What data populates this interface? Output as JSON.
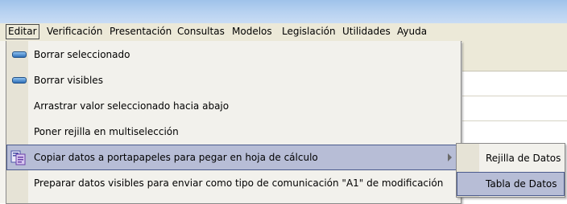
{
  "menubar": {
    "items": [
      {
        "label": "Editar",
        "active": true
      },
      {
        "label": "Verificación",
        "active": false
      },
      {
        "label": "Presentación",
        "active": false
      },
      {
        "label": "Consultas",
        "active": false
      },
      {
        "label": "Modelos",
        "active": false
      },
      {
        "label": "Legislación",
        "active": false
      },
      {
        "label": "Utilidades",
        "active": false
      },
      {
        "label": "Ayuda",
        "active": false
      }
    ]
  },
  "edit_menu": {
    "items": [
      {
        "label": "Borrar seleccionado",
        "icon": "blue-pill-icon"
      },
      {
        "label": "Borrar visibles",
        "icon": "blue-pill-icon"
      },
      {
        "label": "Arrastrar valor seleccionado hacia abajo",
        "icon": ""
      },
      {
        "label": "Poner rejilla en multiselección",
        "icon": ""
      },
      {
        "label": "Copiar datos a portapapeles para pegar en hoja de cálculo",
        "icon": "clipboard-copy-icon",
        "highlighted": true,
        "has_submenu": true
      },
      {
        "label": "Preparar datos visibles para enviar como tipo de comunicación \"A1\" de modificación",
        "icon": ""
      }
    ]
  },
  "copy_submenu": {
    "items": [
      {
        "label": "Rejilla de Datos",
        "highlighted": false
      },
      {
        "label": "Tabla de Datos",
        "highlighted": true
      }
    ]
  },
  "colors": {
    "highlight": "#b7bdd6",
    "highlight_border": "#4a5a8c",
    "menu_bg": "#f2f1ec",
    "menubar_bg": "#ece9d8",
    "title_gradient": "#9fc2ea"
  }
}
